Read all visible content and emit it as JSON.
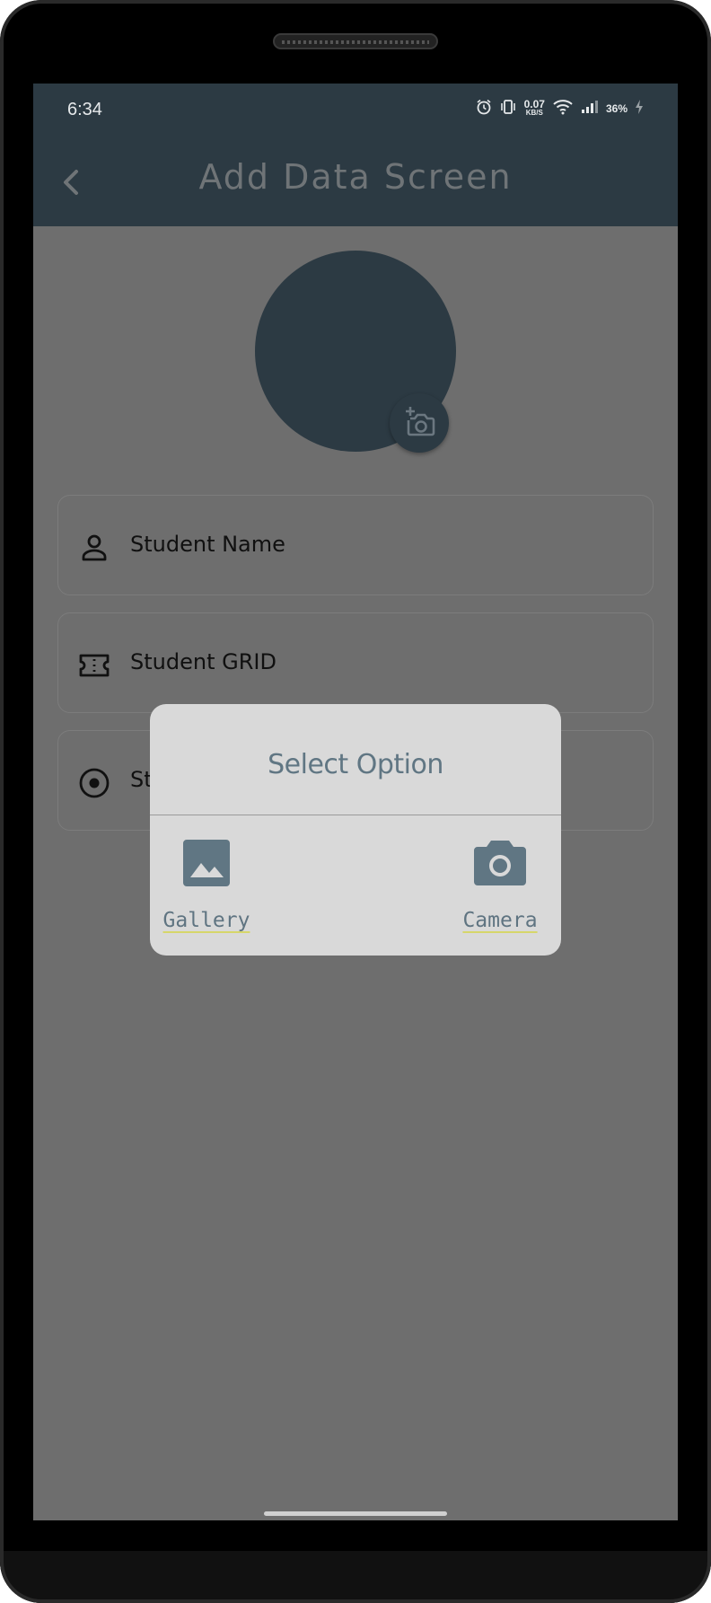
{
  "status_bar": {
    "time": "6:34",
    "net_speed_value": "0.07",
    "net_speed_unit": "KB/S",
    "battery": "36%",
    "icons": [
      "alarm-icon",
      "vibrate-icon",
      "wifi-icon",
      "signal-icon",
      "charging-icon"
    ]
  },
  "app_bar": {
    "title": "Add Data Screen",
    "back_icon": "chevron-left-icon"
  },
  "form": {
    "fields": [
      {
        "label": "Student Name",
        "icon": "person-icon"
      },
      {
        "label": "Student GRID",
        "icon": "ticket-icon"
      },
      {
        "label": "St",
        "icon": "radio-target-icon"
      }
    ],
    "avatar_button_icon": "add-photo-icon"
  },
  "dialog": {
    "title": "Select Option",
    "options": [
      {
        "label": "Gallery",
        "icon": "image-icon"
      },
      {
        "label": "Camera",
        "icon": "camera-icon"
      }
    ]
  },
  "colors": {
    "app_bar": "#2c3a43",
    "scrim": "#6e6e6e",
    "dialog_bg": "#d9d9d9",
    "dialog_accent": "#607683"
  }
}
